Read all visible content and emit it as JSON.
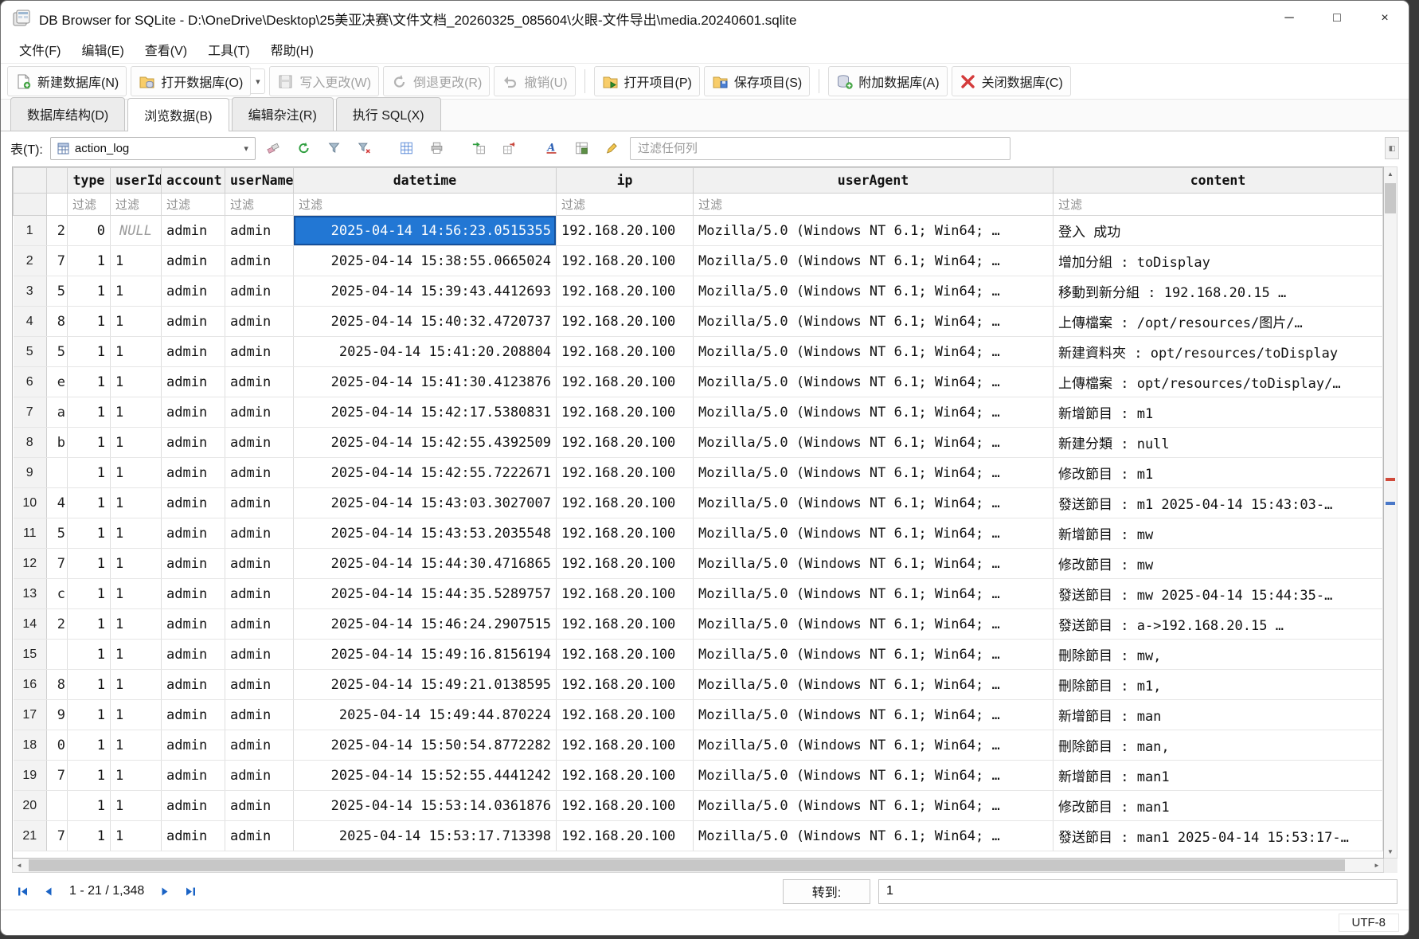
{
  "window": {
    "title": "DB Browser for SQLite - D:\\OneDrive\\Desktop\\25美亚决赛\\文件文档_20260325_085604\\火眼-文件导出\\media.20240601.sqlite"
  },
  "icons": {
    "minimize": "─",
    "maximize": "□",
    "close": "×",
    "dropdown_arrow": "▾",
    "scroll_up": "▲",
    "scroll_down": "▼",
    "scroll_left": "◄",
    "scroll_right": "►",
    "panel_toggle": "◧"
  },
  "menubar": {
    "items": [
      "文件(F)",
      "编辑(E)",
      "查看(V)",
      "工具(T)",
      "帮助(H)"
    ]
  },
  "toolbar": {
    "buttons": [
      {
        "label": "新建数据库(N)",
        "enabled": true
      },
      {
        "label": "打开数据库(O)",
        "enabled": true
      },
      {
        "label": "写入更改(W)",
        "enabled": false
      },
      {
        "label": "倒退更改(R)",
        "enabled": false
      },
      {
        "label": "撤销(U)",
        "enabled": false
      },
      {
        "label": "打开项目(P)",
        "enabled": true
      },
      {
        "label": "保存项目(S)",
        "enabled": true
      },
      {
        "label": "附加数据库(A)",
        "enabled": true
      },
      {
        "label": "关闭数据库(C)",
        "enabled": true
      }
    ]
  },
  "tabs": [
    {
      "label": "数据库结构(D)",
      "active": false
    },
    {
      "label": "浏览数据(B)",
      "active": true
    },
    {
      "label": "编辑杂注(R)",
      "active": false
    },
    {
      "label": "执行 SQL(X)",
      "active": false
    }
  ],
  "browse": {
    "table_label": "表(T):",
    "table_name": "action_log",
    "filter_any_placeholder": "过滤任何列"
  },
  "grid": {
    "columns": [
      "type",
      "userId",
      "account",
      "userName",
      "datetime",
      "ip",
      "userAgent",
      "content"
    ],
    "filter_placeholder": "过滤",
    "ip": "192.168.20.100",
    "user_agent": "Mozilla/5.0 (Windows NT 6.1; Win64; …",
    "rows": [
      {
        "n": "1",
        "frag": "2",
        "type": "0",
        "user_id": "NULL",
        "account": "admin",
        "user_name": "admin",
        "datetime": "2025-04-14 14:56:23.0515355",
        "content": "登入 成功",
        "selected": true
      },
      {
        "n": "2",
        "frag": "7",
        "type": "1",
        "user_id": "1",
        "account": "admin",
        "user_name": "admin",
        "datetime": "2025-04-14 15:38:55.0665024",
        "content": "增加分組 : toDisplay"
      },
      {
        "n": "3",
        "frag": "5",
        "type": "1",
        "user_id": "1",
        "account": "admin",
        "user_name": "admin",
        "datetime": "2025-04-14 15:39:43.4412693",
        "content": "移動到新分組 : 192.168.20.15 …"
      },
      {
        "n": "4",
        "frag": "8",
        "type": "1",
        "user_id": "1",
        "account": "admin",
        "user_name": "admin",
        "datetime": "2025-04-14 15:40:32.4720737",
        "content": "上傳檔案 : /opt/resources/图片/…"
      },
      {
        "n": "5",
        "frag": "5",
        "type": "1",
        "user_id": "1",
        "account": "admin",
        "user_name": "admin",
        "datetime": "2025-04-14 15:41:20.208804",
        "content": "新建資料夾 : opt/resources/toDisplay"
      },
      {
        "n": "6",
        "frag": "e",
        "type": "1",
        "user_id": "1",
        "account": "admin",
        "user_name": "admin",
        "datetime": "2025-04-14 15:41:30.4123876",
        "content": "上傳檔案 : opt/resources/toDisplay/…"
      },
      {
        "n": "7",
        "frag": "a",
        "type": "1",
        "user_id": "1",
        "account": "admin",
        "user_name": "admin",
        "datetime": "2025-04-14 15:42:17.5380831",
        "content": "新增節目 : m1"
      },
      {
        "n": "8",
        "frag": "b",
        "type": "1",
        "user_id": "1",
        "account": "admin",
        "user_name": "admin",
        "datetime": "2025-04-14 15:42:55.4392509",
        "content": "新建分類 : null"
      },
      {
        "n": "9",
        "frag": "",
        "type": "1",
        "user_id": "1",
        "account": "admin",
        "user_name": "admin",
        "datetime": "2025-04-14 15:42:55.7222671",
        "content": "修改節目 : m1"
      },
      {
        "n": "10",
        "frag": "4",
        "type": "1",
        "user_id": "1",
        "account": "admin",
        "user_name": "admin",
        "datetime": "2025-04-14 15:43:03.3027007",
        "content": "發送節目 : m1 2025-04-14 15:43:03-…"
      },
      {
        "n": "11",
        "frag": "5",
        "type": "1",
        "user_id": "1",
        "account": "admin",
        "user_name": "admin",
        "datetime": "2025-04-14 15:43:53.2035548",
        "content": "新增節目 : mw"
      },
      {
        "n": "12",
        "frag": "7",
        "type": "1",
        "user_id": "1",
        "account": "admin",
        "user_name": "admin",
        "datetime": "2025-04-14 15:44:30.4716865",
        "content": "修改節目 : mw"
      },
      {
        "n": "13",
        "frag": "c",
        "type": "1",
        "user_id": "1",
        "account": "admin",
        "user_name": "admin",
        "datetime": "2025-04-14 15:44:35.5289757",
        "content": "發送節目 : mw 2025-04-14 15:44:35-…"
      },
      {
        "n": "14",
        "frag": "2",
        "type": "1",
        "user_id": "1",
        "account": "admin",
        "user_name": "admin",
        "datetime": "2025-04-14 15:46:24.2907515",
        "content": "發送節目 : a->192.168.20.15 …"
      },
      {
        "n": "15",
        "frag": "",
        "type": "1",
        "user_id": "1",
        "account": "admin",
        "user_name": "admin",
        "datetime": "2025-04-14 15:49:16.8156194",
        "content": "刪除節目 : mw,"
      },
      {
        "n": "16",
        "frag": "8",
        "type": "1",
        "user_id": "1",
        "account": "admin",
        "user_name": "admin",
        "datetime": "2025-04-14 15:49:21.0138595",
        "content": "刪除節目 : m1,"
      },
      {
        "n": "17",
        "frag": "9",
        "type": "1",
        "user_id": "1",
        "account": "admin",
        "user_name": "admin",
        "datetime": "2025-04-14 15:49:44.870224",
        "content": "新增節目 : man"
      },
      {
        "n": "18",
        "frag": "0",
        "type": "1",
        "user_id": "1",
        "account": "admin",
        "user_name": "admin",
        "datetime": "2025-04-14 15:50:54.8772282",
        "content": "刪除節目 : man,"
      },
      {
        "n": "19",
        "frag": "7",
        "type": "1",
        "user_id": "1",
        "account": "admin",
        "user_name": "admin",
        "datetime": "2025-04-14 15:52:55.4441242",
        "content": "新增節目 : man1"
      },
      {
        "n": "20",
        "frag": "",
        "type": "1",
        "user_id": "1",
        "account": "admin",
        "user_name": "admin",
        "datetime": "2025-04-14 15:53:14.0361876",
        "content": "修改節目 : man1"
      },
      {
        "n": "21",
        "frag": "7",
        "type": "1",
        "user_id": "1",
        "account": "admin",
        "user_name": "admin",
        "datetime": "2025-04-14 15:53:17.713398",
        "content": "發送節目 : man1 2025-04-14 15:53:17-…"
      }
    ]
  },
  "pagination": {
    "range": "1 - 21 / 1,348",
    "goto_label": "转到:",
    "goto_value": "1"
  },
  "statusbar": {
    "encoding": "UTF-8"
  }
}
